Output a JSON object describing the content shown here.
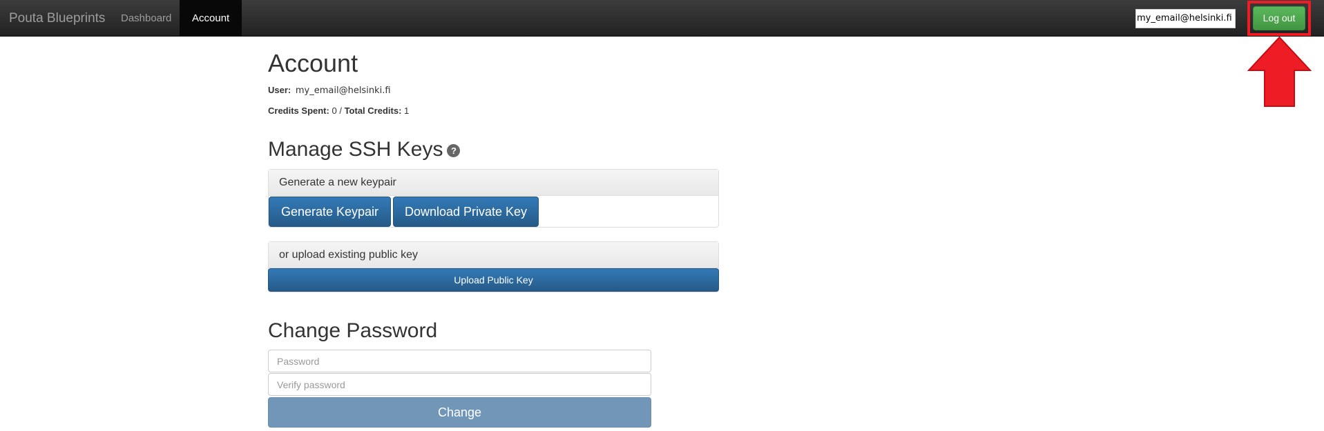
{
  "navbar": {
    "brand": "Pouta Blueprints",
    "links": [
      {
        "label": "Dashboard",
        "active": false
      },
      {
        "label": "Account",
        "active": true
      }
    ],
    "user_email": "my_email@helsinki.fi",
    "logout_label": "Log out",
    "highlight_color": "#ee1c24"
  },
  "account": {
    "title": "Account",
    "user_label": "User:",
    "user_email": "my_email@helsinki.fi",
    "credits_spent_label": "Credits Spent:",
    "credits_spent": "0",
    "credits_separator": "/",
    "total_credits_label": "Total Credits:",
    "total_credits": "1"
  },
  "ssh": {
    "title": "Manage SSH Keys",
    "help_icon": "question-circle-icon",
    "generate_heading": "Generate a new keypair",
    "generate_button": "Generate Keypair",
    "download_button": "Download Private Key",
    "upload_heading": "or upload existing public key",
    "upload_button": "Upload Public Key"
  },
  "password": {
    "title": "Change Password",
    "password_placeholder": "Password",
    "verify_placeholder": "Verify password",
    "change_button": "Change"
  },
  "colors": {
    "primary": "#337ab7",
    "success": "#5cb85c",
    "navbar": "#222222"
  }
}
